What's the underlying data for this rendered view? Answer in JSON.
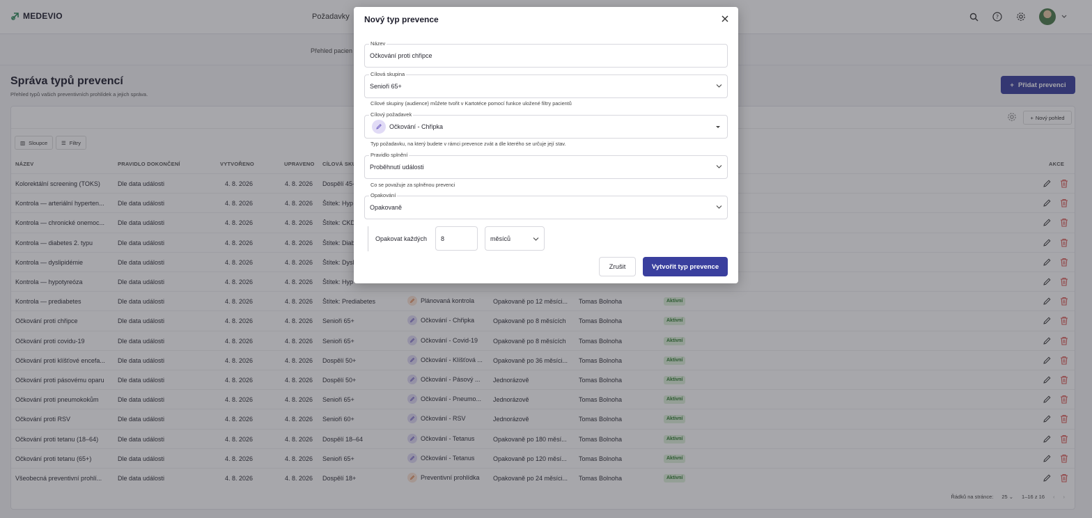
{
  "brand": {
    "name": "MEDEVIO",
    "accent": "#3a3f9e"
  },
  "topnav": {
    "link": "Požadavky"
  },
  "subnav": {
    "link": "Přehled pacien"
  },
  "page": {
    "title": "Správa typů prevencí",
    "subtitle": "Přehled typů vašich preventivních prohlídek a jejich správa.",
    "add_button": "Přidat prevenci"
  },
  "toolbar": {
    "new_view": "Nový pohled",
    "columns": "Sloupce",
    "filters": "Filtry"
  },
  "table": {
    "headers": {
      "name": "NÁZEV",
      "rule": "PRAVIDLO DOKONČENÍ",
      "created": "VYTVOŘENO",
      "updated": "UPRAVENO",
      "target": "CÍLOVÁ SKU",
      "actions": "AKCE"
    },
    "rows": [
      {
        "name": "Kolorektální screening (TOKS)",
        "rule": "Dle data události",
        "created": "4. 8. 2026",
        "updated": "4. 8. 2026",
        "target": "Dospělí 45-",
        "request": "",
        "req_kind": "",
        "repeat": "",
        "author": "",
        "status": ""
      },
      {
        "name": "Kontrola — arteriální hyperten...",
        "rule": "Dle data události",
        "created": "4. 8. 2026",
        "updated": "4. 8. 2026",
        "target": "Štítek: Hyp",
        "request": "",
        "req_kind": "",
        "repeat": "",
        "author": "",
        "status": ""
      },
      {
        "name": "Kontrola — chronické onemoc...",
        "rule": "Dle data události",
        "created": "4. 8. 2026",
        "updated": "4. 8. 2026",
        "target": "Štítek: CKD",
        "request": "",
        "req_kind": "",
        "repeat": "",
        "author": "",
        "status": ""
      },
      {
        "name": "Kontrola — diabetes 2. typu",
        "rule": "Dle data události",
        "created": "4. 8. 2026",
        "updated": "4. 8. 2026",
        "target": "Štítek: Diab",
        "request": "",
        "req_kind": "",
        "repeat": "",
        "author": "",
        "status": ""
      },
      {
        "name": "Kontrola — dyslipidémie",
        "rule": "Dle data události",
        "created": "4. 8. 2026",
        "updated": "4. 8. 2026",
        "target": "Štítek: Dysl",
        "request": "",
        "req_kind": "",
        "repeat": "",
        "author": "",
        "status": ""
      },
      {
        "name": "Kontrola — hypotyreóza",
        "rule": "Dle data události",
        "created": "4. 8. 2026",
        "updated": "4. 8. 2026",
        "target": "Štítek: Hyp",
        "request": "",
        "req_kind": "",
        "repeat": "",
        "author": "",
        "status": ""
      },
      {
        "name": "Kontrola — prediabetes",
        "rule": "Dle data události",
        "created": "4. 8. 2026",
        "updated": "4. 8. 2026",
        "target": "Štítek: Prediabetes",
        "request": "Plánovaná kontrola",
        "req_kind": "orange",
        "repeat": "Opakovaně po 12 měsíci...",
        "author": "Tomas Bolnoha",
        "status": "Aktivní"
      },
      {
        "name": "Očkování proti chřipce",
        "rule": "Dle data události",
        "created": "4. 8. 2026",
        "updated": "4. 8. 2026",
        "target": "Senioři 65+",
        "request": "Očkování - Chřipka",
        "req_kind": "purple",
        "repeat": "Opakovaně po 8 měsících",
        "author": "Tomas Bolnoha",
        "status": "Aktivní"
      },
      {
        "name": "Očkování proti covidu-19",
        "rule": "Dle data události",
        "created": "4. 8. 2026",
        "updated": "4. 8. 2026",
        "target": "Senioři 65+",
        "request": "Očkování - Covid-19",
        "req_kind": "purple",
        "repeat": "Opakovaně po 8 měsících",
        "author": "Tomas Bolnoha",
        "status": "Aktivní"
      },
      {
        "name": "Očkování proti klíšťové encefa...",
        "rule": "Dle data události",
        "created": "4. 8. 2026",
        "updated": "4. 8. 2026",
        "target": "Dospělí 50+",
        "request": "Očkování - Klíšťová ...",
        "req_kind": "purple",
        "repeat": "Opakovaně po 36 měsíci...",
        "author": "Tomas Bolnoha",
        "status": "Aktivní"
      },
      {
        "name": "Očkování proti pásovému oparu",
        "rule": "Dle data události",
        "created": "4. 8. 2026",
        "updated": "4. 8. 2026",
        "target": "Dospělí 50+",
        "request": "Očkování - Pásový ...",
        "req_kind": "purple",
        "repeat": "Jednorázově",
        "author": "Tomas Bolnoha",
        "status": "Aktivní"
      },
      {
        "name": "Očkování proti pneumokokům",
        "rule": "Dle data události",
        "created": "4. 8. 2026",
        "updated": "4. 8. 2026",
        "target": "Senioři 65+",
        "request": "Očkování - Pneumo...",
        "req_kind": "purple",
        "repeat": "Jednorázově",
        "author": "Tomas Bolnoha",
        "status": "Aktivní"
      },
      {
        "name": "Očkování proti RSV",
        "rule": "Dle data události",
        "created": "4. 8. 2026",
        "updated": "4. 8. 2026",
        "target": "Senioři 60+",
        "request": "Očkování - RSV",
        "req_kind": "purple",
        "repeat": "Jednorázově",
        "author": "Tomas Bolnoha",
        "status": "Aktivní"
      },
      {
        "name": "Očkování proti tetanu (18–64)",
        "rule": "Dle data události",
        "created": "4. 8. 2026",
        "updated": "4. 8. 2026",
        "target": "Dospělí 18–64",
        "request": "Očkování - Tetanus",
        "req_kind": "purple",
        "repeat": "Opakovaně po 180 měsí...",
        "author": "Tomas Bolnoha",
        "status": "Aktivní"
      },
      {
        "name": "Očkování proti tetanu (65+)",
        "rule": "Dle data události",
        "created": "4. 8. 2026",
        "updated": "4. 8. 2026",
        "target": "Senioři 65+",
        "request": "Očkování - Tetanus",
        "req_kind": "purple",
        "repeat": "Opakovaně po 120 měsí...",
        "author": "Tomas Bolnoha",
        "status": "Aktivní"
      },
      {
        "name": "Všeobecná preventivní prohlí...",
        "rule": "Dle data události",
        "created": "4. 8. 2026",
        "updated": "4. 8. 2026",
        "target": "Dospělí 18+",
        "request": "Preventivní prohlídka",
        "req_kind": "orange",
        "repeat": "Opakovaně po 24 měsíci...",
        "author": "Tomas Bolnoha",
        "status": "Aktivní"
      }
    ]
  },
  "pager": {
    "rows_label": "Řádků na stránce:",
    "rows_value": "25",
    "range": "1–16 z 16"
  },
  "modal": {
    "title": "Nový typ prevence",
    "name_label": "Název",
    "name_value": "Očkování proti chřipce",
    "audience_label": "Cílová skupina",
    "audience_value": "Senioři 65+",
    "audience_hint": "Cílové skupiny (audience) můžete tvořit v Kartotéce pomocí funkce uložené filtry pacientů",
    "request_label": "Cílový požadavek",
    "request_value": "Očkování - Chřipka",
    "request_hint": "Typ požadavku, na který budete v rámci prevence zvát a dle kterého se určuje její stav.",
    "rule_label": "Pravidlo splnění",
    "rule_value": "Proběhnutí události",
    "rule_hint": "Co se považuje za splněnou prevenci",
    "repeat_label": "Opakování",
    "repeat_value": "Opakovaně",
    "repeat_every_label": "Opakovat každých",
    "repeat_every_value": "8",
    "repeat_unit": "měsíců",
    "cancel": "Zrušit",
    "submit": "Vytvořit typ prevence"
  }
}
